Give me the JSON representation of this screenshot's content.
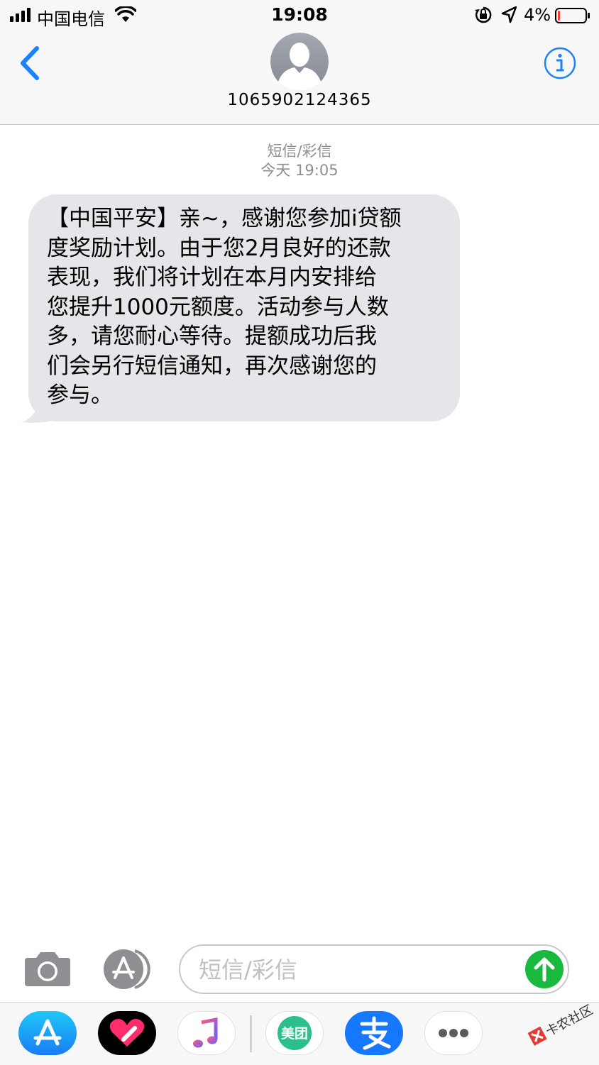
{
  "status_bar": {
    "carrier": "中国电信",
    "time": "19:08",
    "battery_percent": "4%",
    "battery_level": 0.04,
    "icons": [
      "signal-icon",
      "wifi-icon",
      "orientation-lock-icon",
      "location-icon",
      "battery-icon"
    ]
  },
  "header": {
    "back_icon": "chevron-left-icon",
    "contact_number": "1065902124365",
    "info_icon": "info-icon",
    "accent_color": "#1a82fb"
  },
  "thread": {
    "service_label": "短信/彩信",
    "timestamp": "今天 19:05",
    "messages": [
      {
        "direction": "incoming",
        "text": "【中国平安】亲~，感谢您参加i贷额\n度奖励计划。由于您2月良好的还款\n表现，我们将计划在本月内安排给\n您提升1000元额度。活动参与人数\n多，请您耐心等待。提额成功后我\n们会另行短信通知，再次感谢您的\n参与。"
      }
    ],
    "bubble_color": "#e5e5ea"
  },
  "composer": {
    "placeholder": "短信/彩信",
    "value": "",
    "camera_icon": "camera-icon",
    "apps_icon": "app-store-icon",
    "send_icon": "arrow-up-icon",
    "send_color": "#19b93f"
  },
  "app_drawer": {
    "apps": [
      {
        "name": "App Store",
        "icon": "app-store-icon"
      },
      {
        "name": "Digital Touch",
        "icon": "heart-icon"
      },
      {
        "name": "Music",
        "icon": "music-note-icon"
      },
      {
        "name": "美团",
        "label": "美团",
        "icon": "meituan-icon"
      },
      {
        "name": "支付宝",
        "icon": "alipay-icon"
      },
      {
        "name": "More",
        "icon": "ellipsis-icon"
      }
    ]
  },
  "watermark": {
    "text": "卡农社区"
  }
}
